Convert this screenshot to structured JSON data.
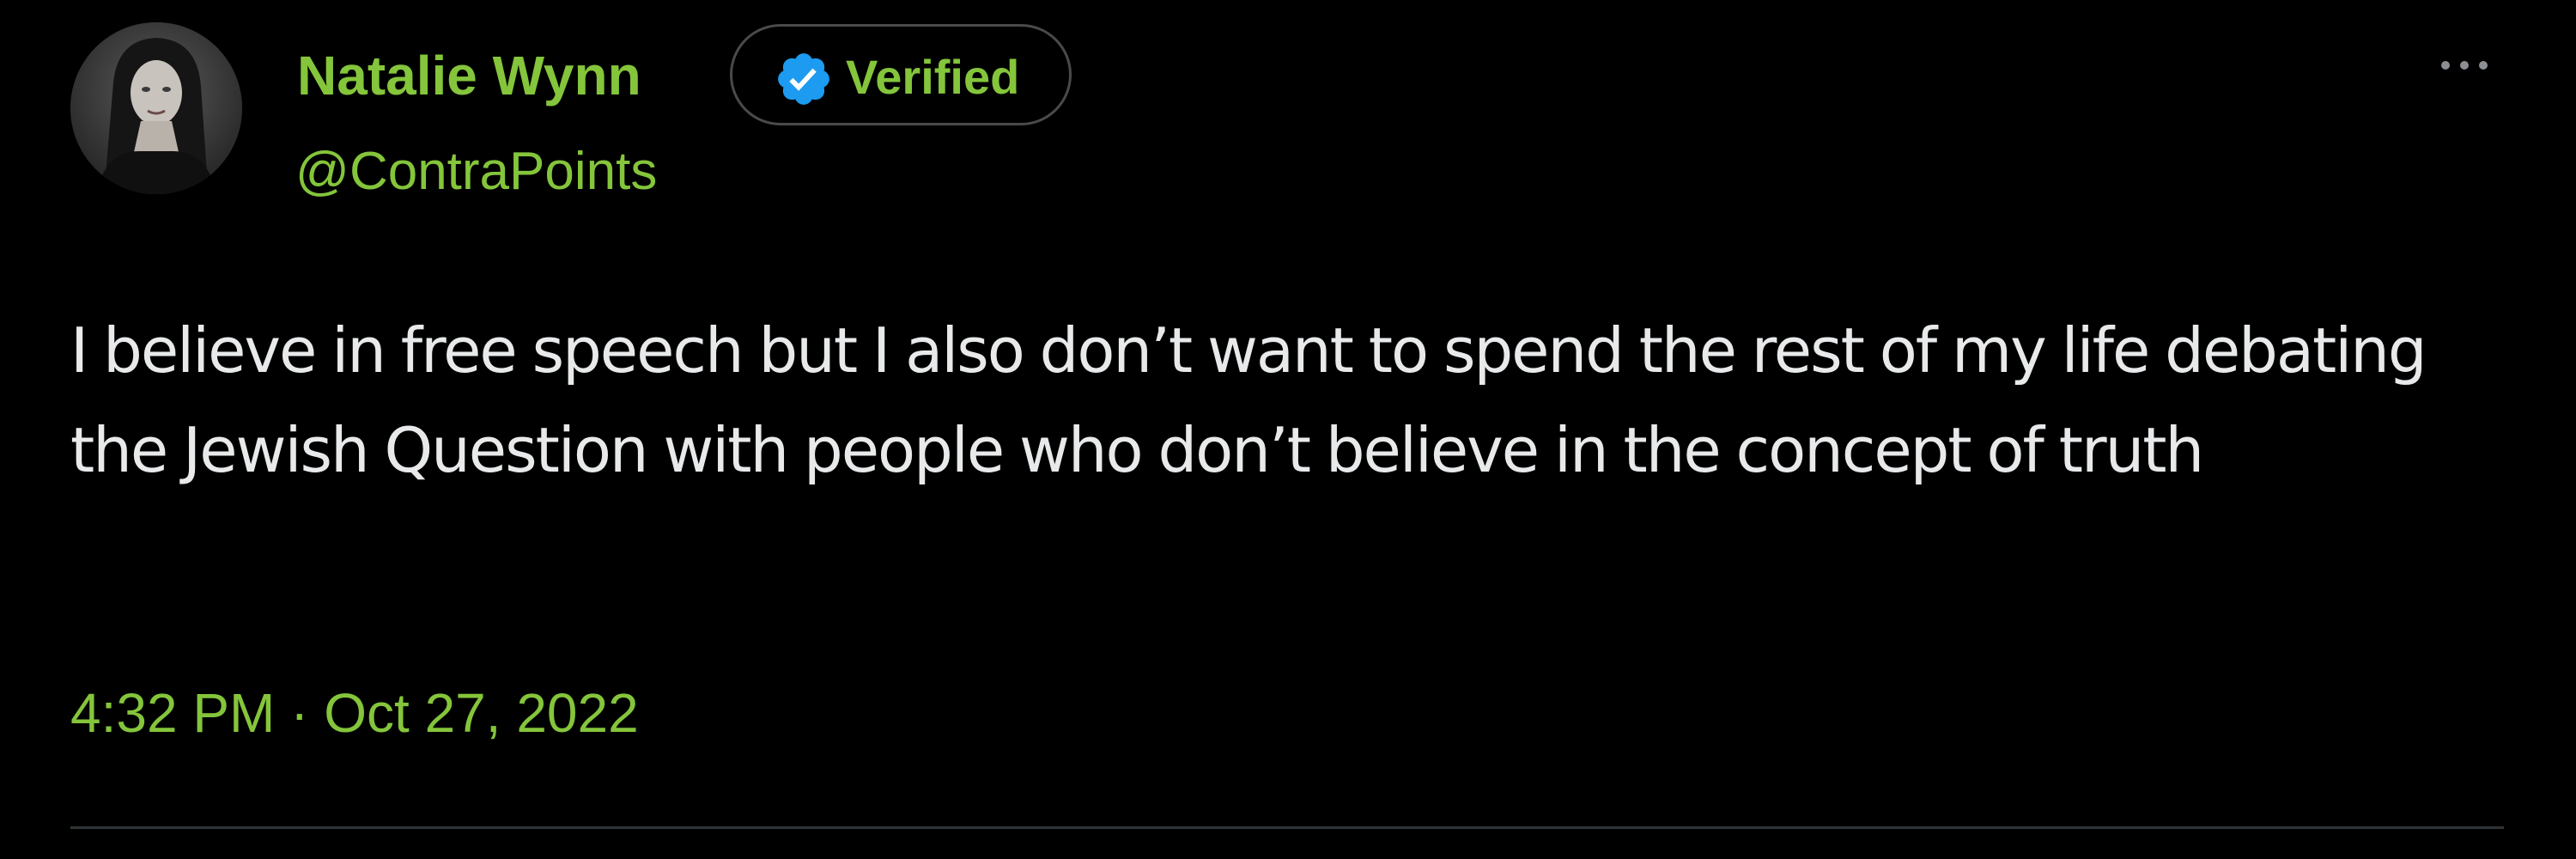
{
  "author": {
    "display_name": "Natalie Wynn",
    "handle": "@ContraPoints",
    "avatar_icon": "profile-photo",
    "verified_label": "Verified",
    "verified_icon": "verified-check-icon"
  },
  "more_icon": "more-options-icon",
  "tweet": {
    "text": "I believe in free speech but I also don’t want to spend the rest of my life debating the Jewish Question with people who don’t believe in the concept of truth",
    "timestamp": "4:32 PM · Oct 27, 2022"
  },
  "colors": {
    "background": "#000000",
    "accent_green": "#84c53b",
    "verified_blue": "#1d9bf0",
    "text": "#e7e9ea",
    "muted_icon": "#8b8f93",
    "divider": "#2f3336",
    "badge_border": "#4a4a4a"
  }
}
